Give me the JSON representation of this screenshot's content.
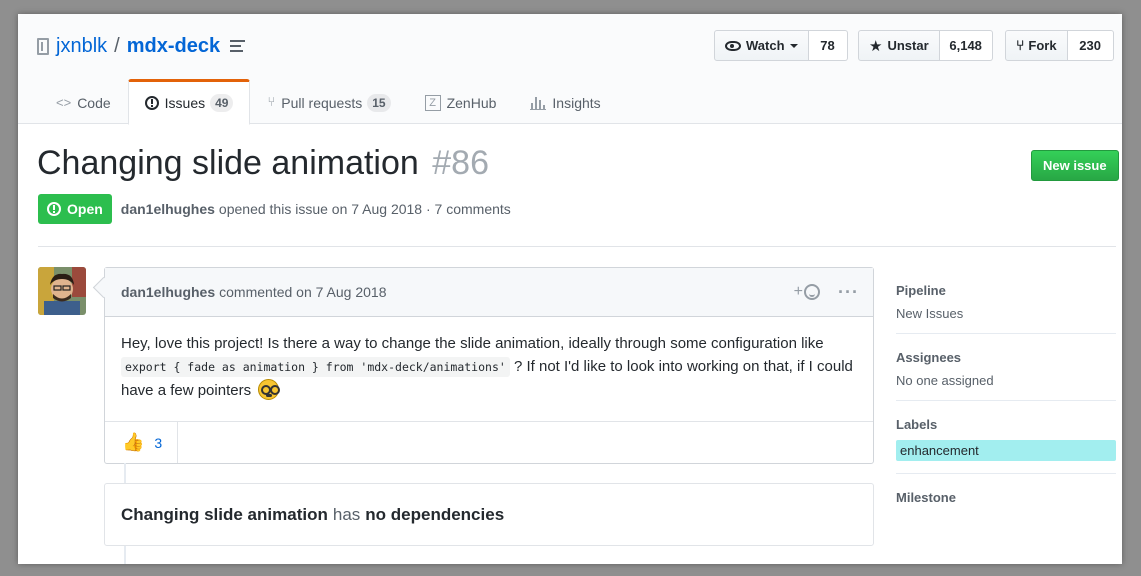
{
  "repo": {
    "owner": "jxnblk",
    "separator": "/",
    "name": "mdx-deck"
  },
  "actions": {
    "watch": {
      "label": "Watch",
      "count": "78"
    },
    "star": {
      "label": "Unstar",
      "count": "6,148"
    },
    "fork": {
      "label": "Fork",
      "count": "230"
    }
  },
  "tabs": [
    {
      "label": "Code",
      "icon": "code-icon"
    },
    {
      "label": "Issues",
      "count": "49",
      "icon": "issue-icon",
      "selected": true
    },
    {
      "label": "Pull requests",
      "count": "15",
      "icon": "pull-request-icon"
    },
    {
      "label": "ZenHub",
      "icon": "zenhub-icon"
    },
    {
      "label": "Insights",
      "icon": "graph-icon"
    }
  ],
  "issue": {
    "title": "Changing slide animation",
    "number": "#86",
    "state": "Open",
    "author": "dan1elhughes",
    "meta": "opened this issue on 7 Aug 2018 · 7 comments",
    "new_issue_label": "New issue"
  },
  "comment": {
    "author": "dan1elhughes",
    "meta": "commented on 7 Aug 2018",
    "body_before": "Hey, love this project! Is there a way to change the slide animation, ideally through some configuration like ",
    "code": "export { fade as animation } from 'mdx-deck/animations'",
    "body_after": " ? If not I'd like to look into working on that, if I could have a few pointers",
    "reaction_count": "3",
    "colors": {
      "thumb": "#d39e00",
      "emoji": "#f7c531"
    }
  },
  "dependencies": {
    "title": "Changing slide animation",
    "has": "has",
    "status": "no dependencies"
  },
  "sidebar": {
    "pipeline": {
      "heading": "Pipeline",
      "value": "New Issues"
    },
    "assignees": {
      "heading": "Assignees",
      "value": "No one assigned"
    },
    "labels": {
      "heading": "Labels",
      "value": "enhancement",
      "color": "#a2eeef"
    },
    "milestone": {
      "heading": "Milestone"
    }
  }
}
